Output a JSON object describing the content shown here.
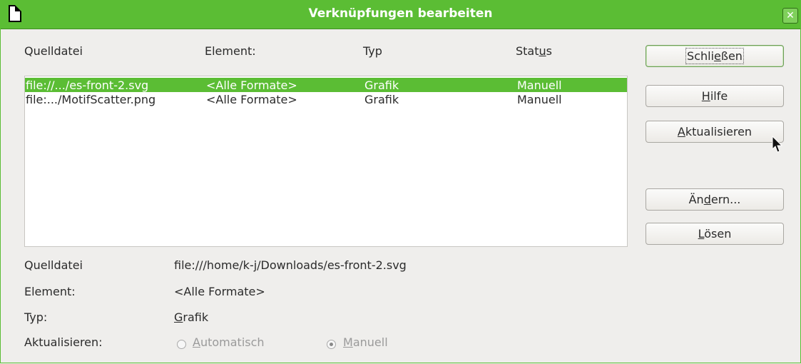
{
  "window": {
    "title": "Verknüpfungen bearbeiten"
  },
  "columns": [
    "Quelldatei",
    "Element:",
    "Typ",
    "Status"
  ],
  "links": [
    {
      "source": "file://.../es-front-2.svg",
      "element": "<Alle Formate>",
      "type": "Grafik",
      "status": "Manuell",
      "selected": true
    },
    {
      "source": "file:.../MotifScatter.png",
      "element": "<Alle Formate>",
      "type": "Grafik",
      "status": "Manuell",
      "selected": false
    }
  ],
  "buttons": {
    "close": {
      "label": "Schließen",
      "underline_index": 2
    },
    "help": {
      "label": "Hilfe",
      "underline_index": 0
    },
    "update": {
      "label": "Aktualisieren",
      "underline_index": 0
    },
    "modify": {
      "label": "Ändern...",
      "underline_index": 2
    },
    "break": {
      "label": "Lösen",
      "underline_index": 0
    }
  },
  "details": {
    "source_label": "Quelldatei",
    "source_value": "file:///home/k-j/Downloads/es-front-2.svg",
    "element_label": "Element:",
    "element_value": "<Alle Formate>",
    "type_label": "Typ:",
    "type_value": "Grafik",
    "update_label": "Aktualisieren:",
    "update_options": [
      {
        "label": "Automatisch",
        "checked": false,
        "enabled": false
      },
      {
        "label": "Manuell",
        "checked": true,
        "enabled": false
      }
    ]
  },
  "icons": {
    "app": "document-icon",
    "close": "close-icon",
    "cursor": "mouse-pointer-icon"
  },
  "colors": {
    "accent": "#5bbd34",
    "selection_text": "#ffffff",
    "background": "#efeeec"
  }
}
